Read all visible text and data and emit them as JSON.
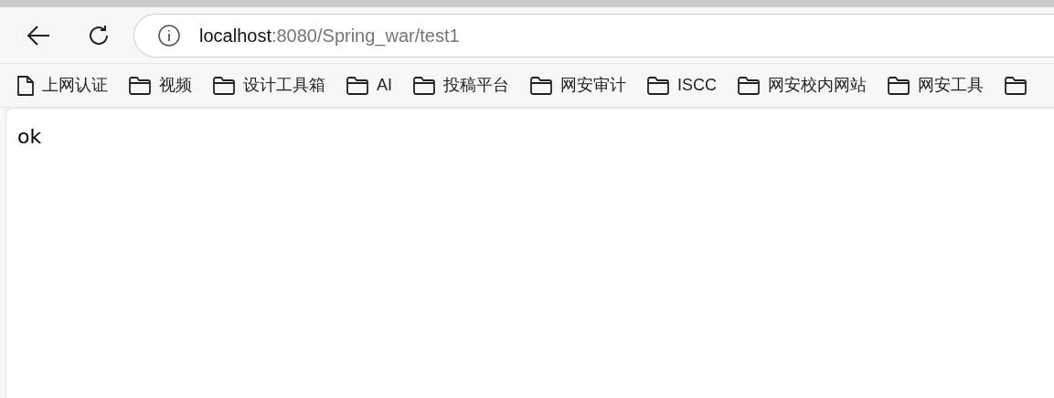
{
  "address_bar": {
    "host": "localhost",
    "path": ":8080/Spring_war/test1"
  },
  "bookmarks": [
    {
      "kind": "page",
      "label": "上网认证"
    },
    {
      "kind": "folder",
      "label": "视频"
    },
    {
      "kind": "folder",
      "label": "设计工具箱"
    },
    {
      "kind": "folder",
      "label": "AI"
    },
    {
      "kind": "folder",
      "label": "投稿平台"
    },
    {
      "kind": "folder",
      "label": "网安审计"
    },
    {
      "kind": "folder",
      "label": "ISCC"
    },
    {
      "kind": "folder",
      "label": "网安校内网站"
    },
    {
      "kind": "folder",
      "label": "网安工具"
    },
    {
      "kind": "folder"
    }
  ],
  "page": {
    "body_text": "ok"
  }
}
